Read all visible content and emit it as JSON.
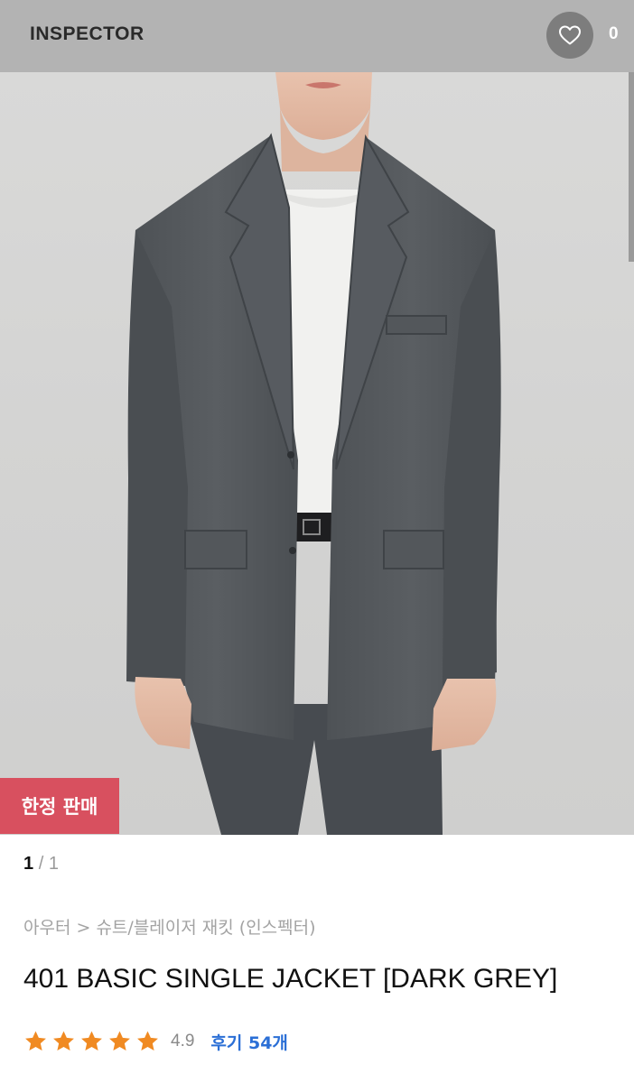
{
  "header": {
    "brand": "INSPECTOR",
    "like_count": "0"
  },
  "hero": {
    "badge": "한정 판매"
  },
  "pager": {
    "current": "1",
    "separator": "/",
    "total": "1"
  },
  "breadcrumb": {
    "category": "아우터",
    "separator": ">",
    "subcategory": "슈트/블레이저 재킷",
    "brand_paren": "(인스펙터)"
  },
  "product": {
    "title": "401 BASIC SINGLE JACKET [DARK GREY]",
    "rating": "4.9",
    "rating_stars": 5,
    "reviews_label": "후기 54개"
  },
  "colors": {
    "accent_blue": "#2b6fd6",
    "star": "#f08a22",
    "badge": "#d8505f"
  },
  "icons": {
    "like": "heart-outline-icon",
    "star": "star-icon"
  }
}
